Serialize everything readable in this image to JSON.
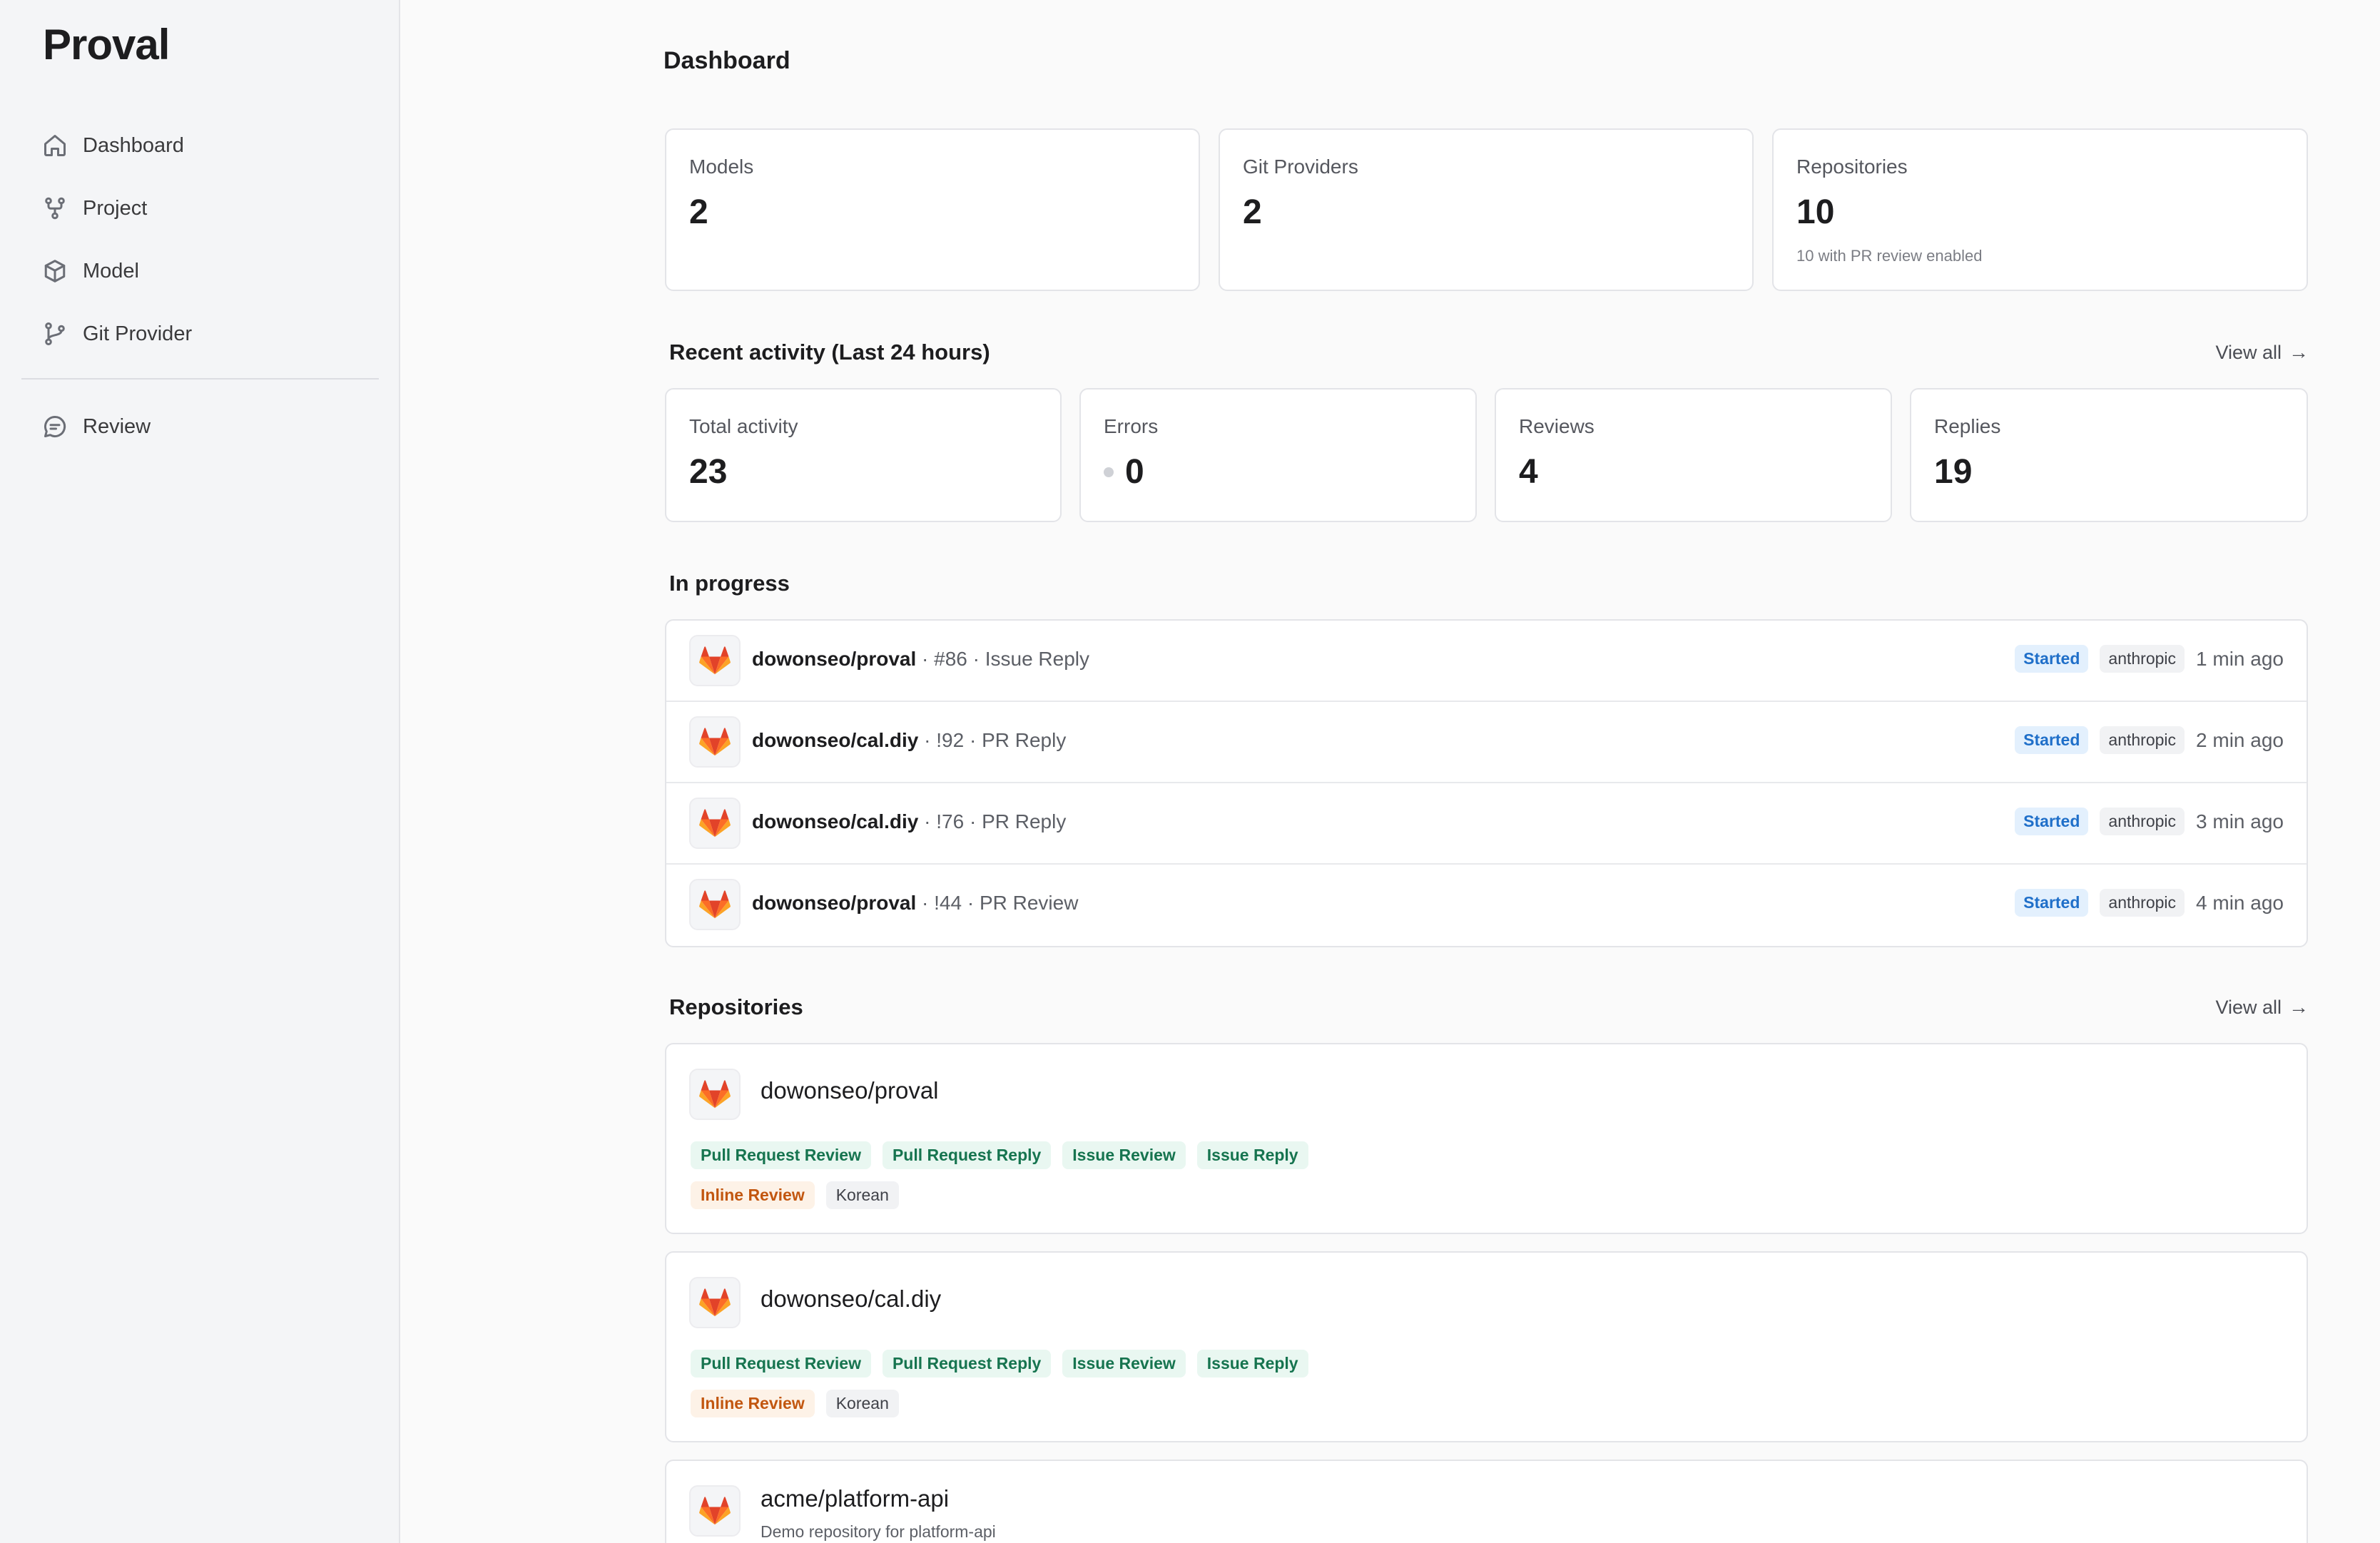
{
  "app": {
    "brand": "Proval"
  },
  "sidebar": {
    "items": [
      {
        "label": "Dashboard",
        "icon": "home-icon"
      },
      {
        "label": "Project",
        "icon": "project-icon"
      },
      {
        "label": "Model",
        "icon": "cube-icon"
      },
      {
        "label": "Git Provider",
        "icon": "git-branch-icon"
      },
      {
        "label": "Review",
        "icon": "chat-icon"
      }
    ]
  },
  "page": {
    "title": "Dashboard"
  },
  "summary": [
    {
      "label": "Models",
      "value": "2",
      "sub": ""
    },
    {
      "label": "Git Providers",
      "value": "2",
      "sub": ""
    },
    {
      "label": "Repositories",
      "value": "10",
      "sub": "10 with PR review enabled"
    }
  ],
  "activity": {
    "title": "Recent activity (Last 24 hours)",
    "view_all": "View all",
    "stats": [
      {
        "label": "Total activity",
        "value": "23"
      },
      {
        "label": "Errors",
        "value": "0"
      },
      {
        "label": "Reviews",
        "value": "4"
      },
      {
        "label": "Replies",
        "value": "19"
      }
    ]
  },
  "in_progress": {
    "title": "In progress",
    "rows": [
      {
        "repo": "dowonseo/proval",
        "detail": " · #86 · Issue Reply",
        "status": "Started",
        "model": "anthropic",
        "time": "1 min ago"
      },
      {
        "repo": "dowonseo/cal.diy",
        "detail": " · !92 · PR Reply",
        "status": "Started",
        "model": "anthropic",
        "time": "2 min ago"
      },
      {
        "repo": "dowonseo/cal.diy",
        "detail": " · !76 · PR Reply",
        "status": "Started",
        "model": "anthropic",
        "time": "3 min ago"
      },
      {
        "repo": "dowonseo/proval",
        "detail": " · !44 · PR Review",
        "status": "Started",
        "model": "anthropic",
        "time": "4 min ago"
      }
    ]
  },
  "repositories": {
    "title": "Repositories",
    "view_all": "View all",
    "items": [
      {
        "name": "dowonseo/proval",
        "description": "",
        "features": [
          "Pull Request Review",
          "Pull Request Reply",
          "Issue Review",
          "Issue Reply"
        ],
        "options": [
          "Inline Review"
        ],
        "language": "Korean"
      },
      {
        "name": "dowonseo/cal.diy",
        "description": "",
        "features": [
          "Pull Request Review",
          "Pull Request Reply",
          "Issue Review",
          "Issue Reply"
        ],
        "options": [
          "Inline Review"
        ],
        "language": "Korean"
      },
      {
        "name": "acme/platform-api",
        "description": "Demo repository for platform-api",
        "features": [],
        "options": [],
        "language": ""
      }
    ]
  },
  "colors": {
    "accent_blue": "#1f6fc9",
    "gitlab_orange": "#fc6d26",
    "tag_green": "#16744f",
    "tag_orange": "#c2560f"
  }
}
